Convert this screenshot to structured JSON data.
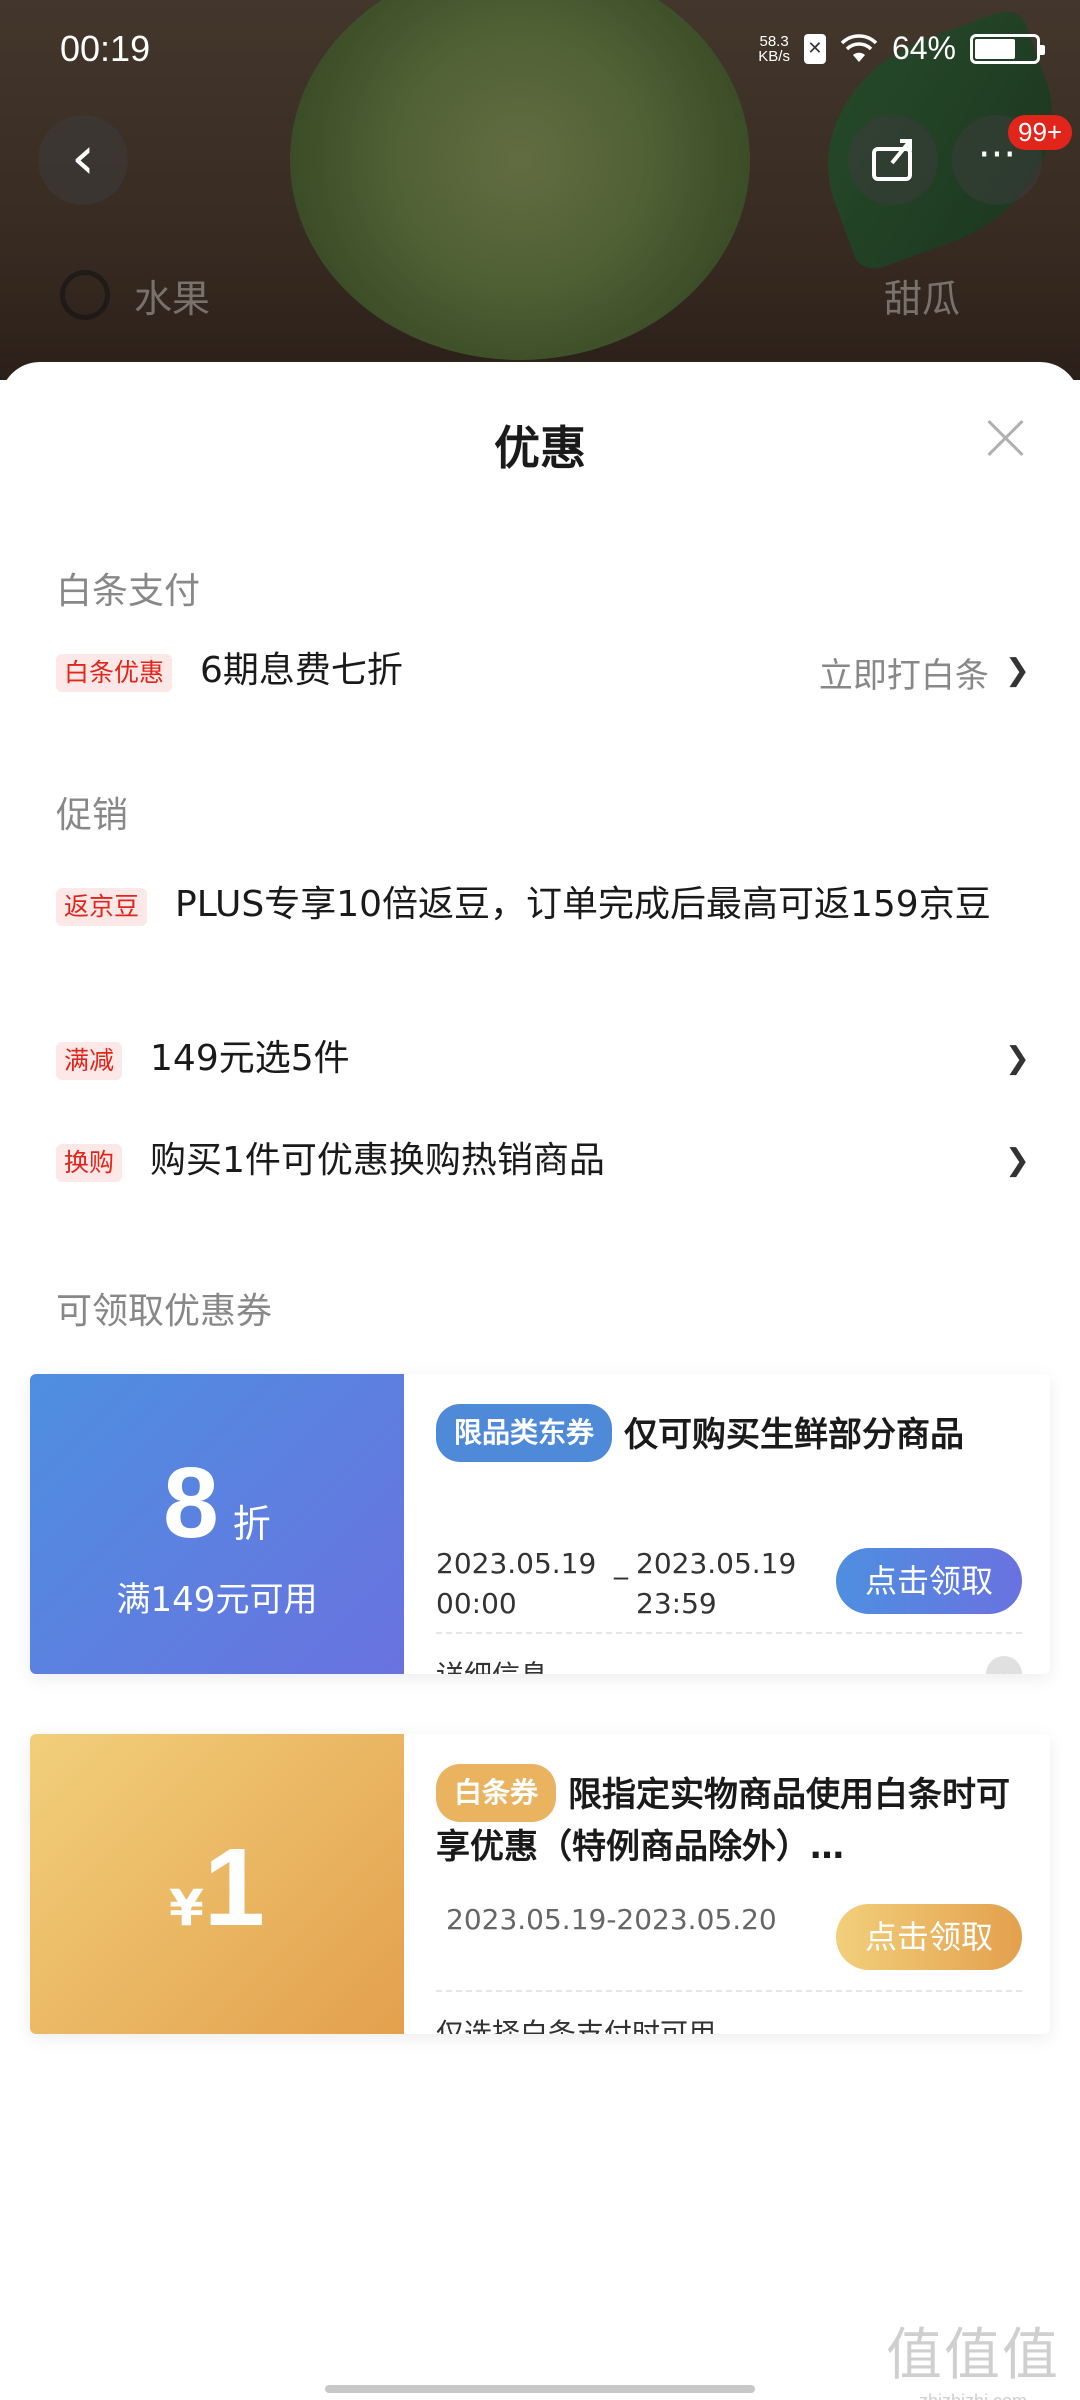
{
  "status_bar": {
    "time": "00:19",
    "net_speed_value": "58.3",
    "net_speed_unit": "KB/s",
    "battery": "64%"
  },
  "background": {
    "nav_badge": "99+",
    "search_text": "水果",
    "search_tag": "甜瓜"
  },
  "sheet": {
    "title": "优惠"
  },
  "baitiao": {
    "section_title": "白条支付",
    "tag": "白条优惠",
    "text": "6期息费七折",
    "action": "立即打白条"
  },
  "promotion": {
    "section_title": "促销",
    "items": [
      {
        "tag": "返京豆",
        "text": "PLUS专享10倍返豆，订单完成后最高可返159京豆"
      },
      {
        "tag": "满减",
        "text": "149元选5件"
      },
      {
        "tag": "换购",
        "text": "购买1件可优惠换购热销商品"
      }
    ]
  },
  "coupons_section": {
    "title": "可领取优惠券"
  },
  "coupons": [
    {
      "amount": "8",
      "unit": "折",
      "condition": "满149元可用",
      "tag": "限品类东券",
      "desc": "仅可购买生鲜部分商品",
      "start_date": "2023.05.19",
      "start_time": "00:00",
      "date_sep": "_",
      "end_date": "2023.05.19",
      "end_time": "23:59",
      "button": "点击领取",
      "note": "详细信息",
      "color": "#5a80e0"
    },
    {
      "currency": "¥",
      "amount": "1",
      "tag": "白条券",
      "desc": "限指定实物商品使用白条时可享优惠（特例商品除外）…",
      "date_range": "2023.05.19-2023.05.20",
      "button": "点击领取",
      "note": "仅选择白条支付时可用",
      "color": "#e9b35f"
    }
  ],
  "watermark": {
    "logo": "值值值",
    "url": "zhizhizhi.com"
  }
}
